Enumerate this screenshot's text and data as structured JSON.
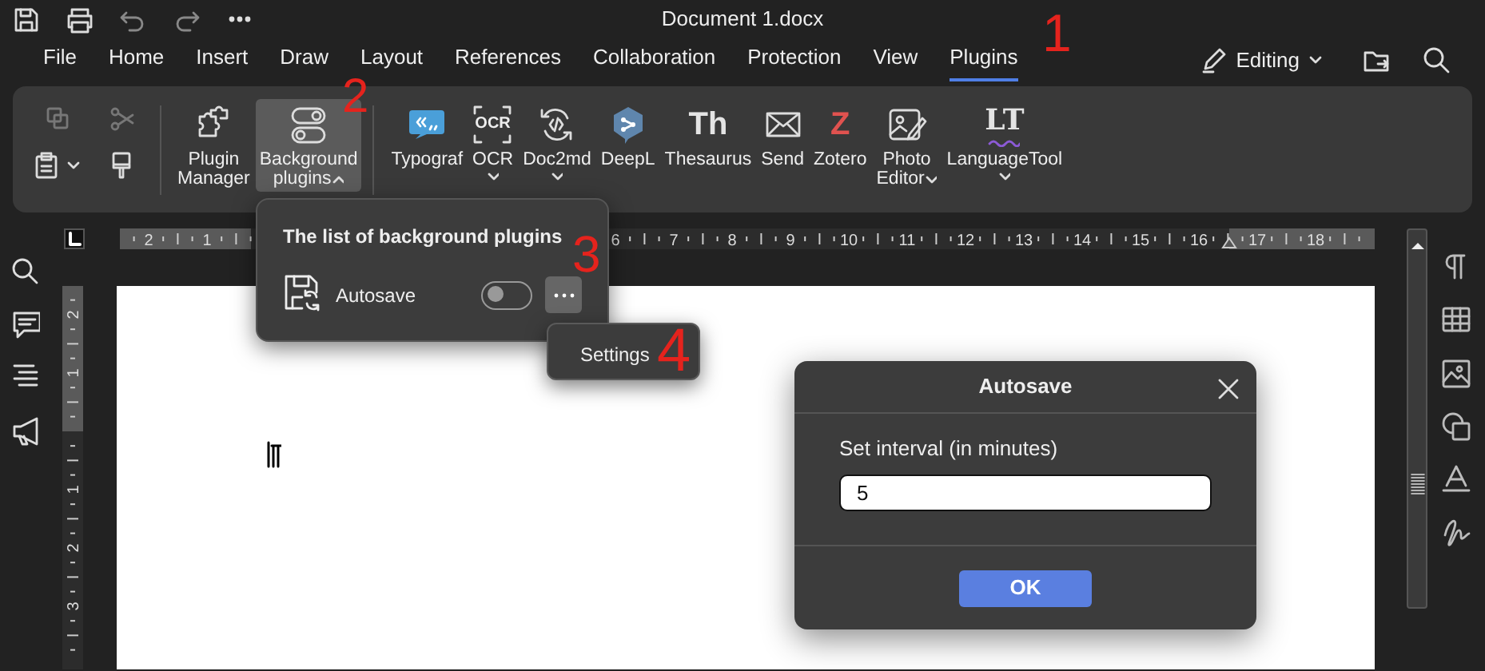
{
  "title_bar": {
    "title": "Document 1.docx"
  },
  "menu_tabs": [
    {
      "label": "File",
      "selected": false
    },
    {
      "label": "Home",
      "selected": false
    },
    {
      "label": "Insert",
      "selected": false
    },
    {
      "label": "Draw",
      "selected": false
    },
    {
      "label": "Layout",
      "selected": false
    },
    {
      "label": "References",
      "selected": false
    },
    {
      "label": "Collaboration",
      "selected": false
    },
    {
      "label": "Protection",
      "selected": false
    },
    {
      "label": "View",
      "selected": false
    },
    {
      "label": "Plugins",
      "selected": true
    }
  ],
  "editing_mode": {
    "label": "Editing"
  },
  "clipboard_tools": [
    {
      "kind": "copy",
      "disabled": true
    },
    {
      "kind": "cut",
      "disabled": true
    },
    {
      "kind": "paste"
    },
    {
      "kind": "painter"
    }
  ],
  "plugin_buttons": [
    {
      "kind": "puzzle",
      "label": "Plugin Manager",
      "caret": false,
      "selected": false
    },
    {
      "kind": "toggles",
      "label": "Background plugins",
      "caret": true,
      "selected": true
    },
    {
      "kind": "typograf",
      "label": "Typograf",
      "caret": false,
      "selected": false
    },
    {
      "kind": "ocr",
      "icon_text": "OCR",
      "label": "OCR",
      "caret": true,
      "selected": false
    },
    {
      "kind": "doc2md",
      "label": "Doc2md",
      "caret": true,
      "selected": false
    },
    {
      "kind": "deepl",
      "label": "DeepL",
      "caret": false,
      "selected": false
    },
    {
      "kind": "thesaurus",
      "icon_text": "Th",
      "label": "Thesaurus",
      "caret": false,
      "selected": false
    },
    {
      "kind": "send",
      "label": "Send",
      "caret": false,
      "selected": false
    },
    {
      "kind": "zotero",
      "icon_text": "Z",
      "label": "Zotero",
      "caret": false,
      "selected": false
    },
    {
      "kind": "photo",
      "label": "Photo Editor",
      "caret": true,
      "selected": false
    },
    {
      "kind": "languagetool",
      "icon_text": "LT",
      "label": "LanguageTool",
      "caret": true,
      "selected": false
    }
  ],
  "rulers": {
    "horizontal": {
      "left_numbers": [
        "2",
        "1"
      ],
      "right_numbers": [
        "6",
        "7",
        "8",
        "9",
        "10",
        "11",
        "12",
        "13",
        "14",
        "15",
        "16",
        "17",
        "18"
      ]
    },
    "vertical": {
      "top_numbers": [
        "2",
        "1"
      ],
      "body_numbers": [
        "1",
        "2",
        "3"
      ]
    }
  },
  "background_plugins": {
    "title": "The list of background plugins",
    "plugins": [
      {
        "name": "Autosave",
        "on": false
      }
    ]
  },
  "context_menu": {
    "items": [
      {
        "label": "Settings"
      }
    ]
  },
  "dialog": {
    "title": "Autosave",
    "field_label": "Set interval (in minutes)",
    "value": "5",
    "button": "OK"
  },
  "annotations": [
    {
      "label": "1"
    },
    {
      "label": "2"
    },
    {
      "label": "3"
    },
    {
      "label": "4"
    }
  ]
}
